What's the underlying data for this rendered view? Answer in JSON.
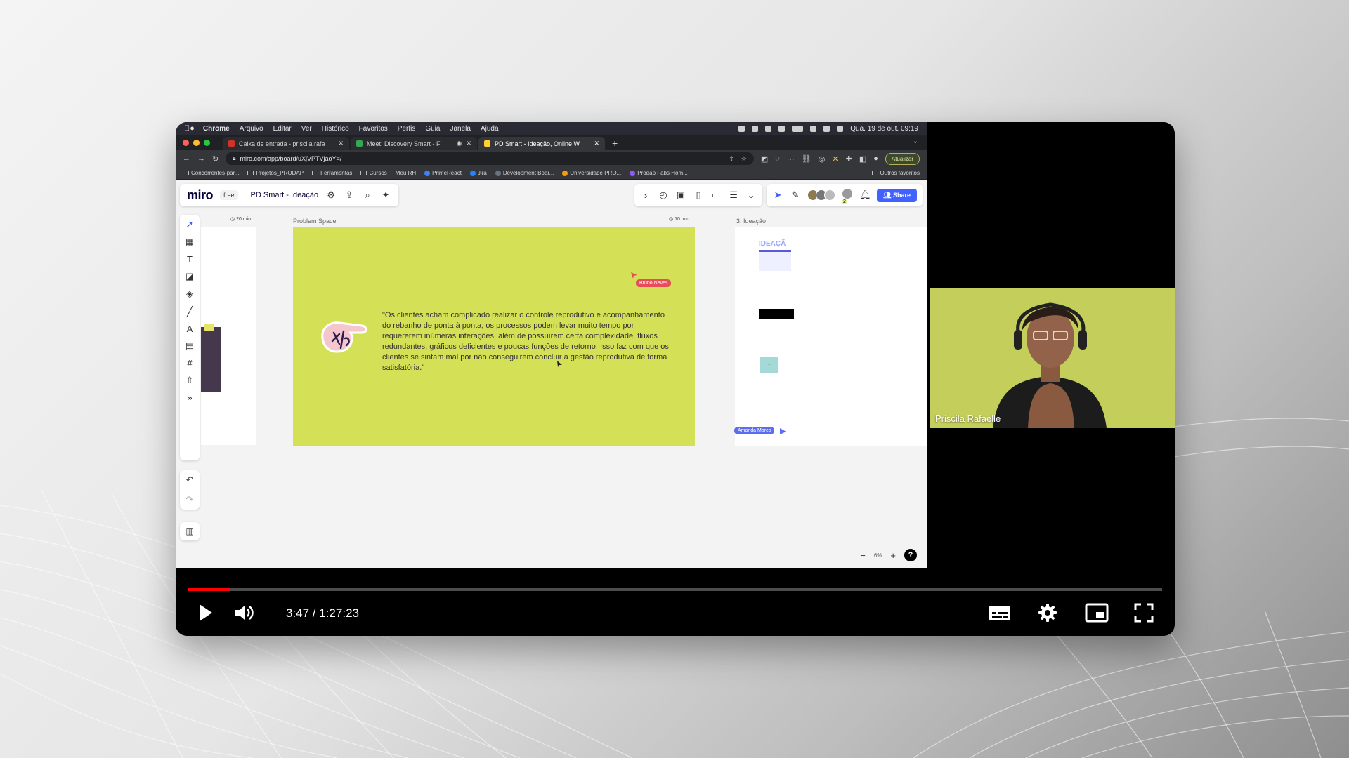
{
  "menubar": {
    "app": "Chrome",
    "items": [
      "Arquivo",
      "Editar",
      "Ver",
      "Histórico",
      "Favoritos",
      "Perfis",
      "Guia",
      "Janela",
      "Ajuda"
    ],
    "datetime": "Qua. 19 de out. 09:19"
  },
  "tabs": [
    {
      "title": "Caixa de entrada - priscila.rafa",
      "color": "#d93025"
    },
    {
      "title": "Meet: Discovery Smart - F",
      "color": "#34a853"
    },
    {
      "title": "PD Smart - Ideação, Online W",
      "color": "#ffd02f"
    }
  ],
  "address": {
    "url": "miro.com/app/board/uXjVPTVjaoY=/",
    "update_label": "Atualizar"
  },
  "bookmarks": [
    {
      "label": "Concorrentes-par...",
      "kind": "folder"
    },
    {
      "label": "Projetos_PRODAP",
      "kind": "folder"
    },
    {
      "label": "Ferramentas",
      "kind": "folder"
    },
    {
      "label": "Cursos",
      "kind": "folder"
    },
    {
      "label": "Meu RH",
      "kind": "site",
      "color": "#9e9e9e"
    },
    {
      "label": "PrimeReact",
      "kind": "site",
      "color": "#3b82f6"
    },
    {
      "label": "Jira",
      "kind": "site",
      "color": "#2684ff"
    },
    {
      "label": "Development Boar...",
      "kind": "site",
      "color": "#6b7280"
    },
    {
      "label": "Universidade PRO...",
      "kind": "site",
      "color": "#f59e0b"
    },
    {
      "label": "Prodap Fabs Hom...",
      "kind": "site",
      "color": "#8b5cf6"
    }
  ],
  "bookmarks_other": "Outros favoritos",
  "miro": {
    "logo": "miro",
    "plan": "free",
    "board_name": "PD Smart - Ideação",
    "share_label": "Share",
    "presence_count": "2",
    "timer_left": "20 min",
    "timer_right": "10 min",
    "frame_problem": "Problem Space",
    "frame_ideation": "3. Ideação",
    "ideation_heading": "IDEAÇÃ",
    "quote": "\"Os clientes acham complicado realizar o controle reprodutivo e acompanhamento do rebanho de ponta à ponta; os processos podem levar muito tempo por requererem inúmeras interações, além de possuírem certa complexidade, fluxos redundantes, gráficos deficientes e poucas funções de retorno. Isso faz com que os clientes se sintam mal por não conseguirem concluir a gestão reprodutiva de forma satisfatória.\"",
    "cursor_bruno": "Bruno Neves",
    "cursor_amanda": "Amanda Marco",
    "zoom": "6%",
    "help": "?",
    "colors": {
      "frame": "#d4e157",
      "share": "#4262ff",
      "bruno": "#e94b59",
      "amanda": "#5b6cf0"
    }
  },
  "webcam": {
    "name": "Priscila Rafaelle"
  },
  "player": {
    "time_display": "3:47 / 1:27:23",
    "progress_played": 0.0433,
    "progress_color": "#ff0000"
  }
}
